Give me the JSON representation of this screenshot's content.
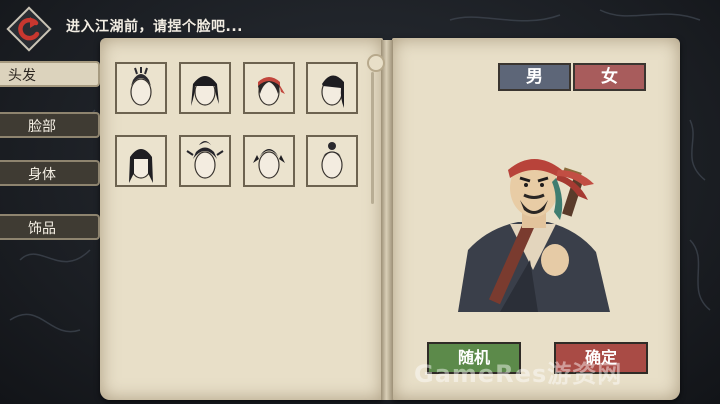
{
  "header": {
    "title": "进入江湖前，请捏个脸吧..."
  },
  "categories": [
    {
      "label": "头发"
    },
    {
      "label": "脸部"
    },
    {
      "label": "身体"
    },
    {
      "label": "饰品"
    }
  ],
  "active_category": "头发",
  "hair_options": [
    {
      "name": "hair-style-1",
      "color": "#2b2a2f"
    },
    {
      "name": "hair-style-2",
      "color": "#1d1c20"
    },
    {
      "name": "hair-style-3",
      "color": "#2a2626",
      "headband": "#c2463c"
    },
    {
      "name": "hair-style-4",
      "color": "#1e1d21"
    },
    {
      "name": "hair-style-5",
      "color": "#1f1e22"
    },
    {
      "name": "hair-style-6",
      "color": "#25242a"
    },
    {
      "name": "hair-style-7",
      "color": "#1f1e22"
    },
    {
      "name": "hair-style-8",
      "color": "#2a292d"
    }
  ],
  "gender": {
    "male": "男",
    "female": "女",
    "selected": "male"
  },
  "actions": {
    "random": "随机",
    "confirm": "确定"
  },
  "watermark": "GameRes游资网",
  "colors": {
    "page": "#e8dfc8",
    "male_button": "#5d6678",
    "female_button": "#a85c5c",
    "random_button": "#5c8a4a",
    "confirm_button": "#a94b45",
    "back_icon": "#c8372f"
  }
}
